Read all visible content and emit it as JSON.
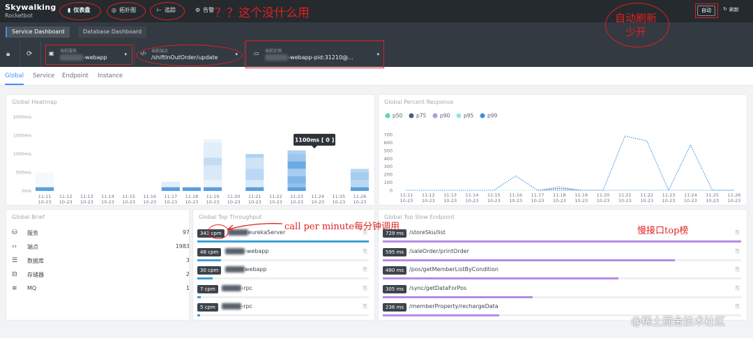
{
  "app": {
    "brand": "Skywalking",
    "subtitle": "Rocketbot"
  },
  "topnav": {
    "items": [
      {
        "label": "仪表盘",
        "icon": "dashboard-icon",
        "glyph": "▮",
        "active": true
      },
      {
        "label": "拓扑图",
        "icon": "topology-icon",
        "glyph": "◎",
        "active": false
      },
      {
        "label": "追踪",
        "icon": "trace-icon",
        "glyph": "⊢",
        "active": false
      },
      {
        "label": "告警",
        "icon": "alarm-icon",
        "glyph": "⚙",
        "active": false
      }
    ],
    "auto_label": "自动",
    "refresh_label": "刷新"
  },
  "dashboards": {
    "tabs": [
      "Service Dashboard",
      "Database Dashboard"
    ],
    "active": 0
  },
  "selectors": {
    "service": {
      "label": "当前服务",
      "value_suffix": "-webapp"
    },
    "endpoint": {
      "label": "当前端点",
      "value": "/shiftInOutOrder/update"
    },
    "instance": {
      "label": "当前实例",
      "value_suffix": "-webapp-pid:31210@..."
    }
  },
  "subtabs": [
    "Global",
    "Service",
    "Endpoint",
    "Instance"
  ],
  "heatmap": {
    "title": "Global Heatmap",
    "tooltip": "1100ms [ 0 ]"
  },
  "percent": {
    "title": "Global Percent Response"
  },
  "chart_data": [
    {
      "type": "heatmap",
      "title": "Global Heatmap",
      "y_ticks": [
        "2000ms",
        "1500ms",
        "1000ms",
        "500ms",
        "0ms"
      ],
      "ylim": [
        0,
        2000
      ],
      "categories": [
        "11:11\n10-23",
        "11:12\n10-23",
        "11:13\n10-23",
        "11:14\n10-23",
        "11:15\n10-23",
        "11:16\n10-23",
        "11:17\n10-23",
        "11:18\n10-23",
        "11:19\n10-23",
        "11:20\n10-23",
        "11:21\n10-23",
        "11:22\n10-23",
        "11:23\n10-23",
        "11:24\n10-23",
        "11:25\n10-23",
        "11:26\n10-23"
      ],
      "cells": [
        {
          "x": 0,
          "bands": [
            [
              0,
              100,
              0.85
            ],
            [
              100,
              500,
              0.05
            ]
          ]
        },
        {
          "x": 6,
          "bands": [
            [
              0,
              100,
              0.85
            ],
            [
              100,
              250,
              0.15
            ]
          ]
        },
        {
          "x": 7,
          "bands": [
            [
              0,
              100,
              0.85
            ]
          ]
        },
        {
          "x": 8,
          "bands": [
            [
              0,
              100,
              0.85
            ],
            [
              100,
              300,
              0.1
            ],
            [
              300,
              700,
              0.2
            ],
            [
              700,
              900,
              0.3
            ],
            [
              900,
              1300,
              0.15
            ],
            [
              1300,
              1400,
              0.1
            ]
          ]
        },
        {
          "x": 10,
          "bands": [
            [
              0,
              100,
              0.85
            ],
            [
              100,
              300,
              0.2
            ],
            [
              300,
              600,
              0.35
            ],
            [
              600,
              900,
              0.25
            ],
            [
              900,
              1000,
              0.4
            ]
          ]
        },
        {
          "x": 12,
          "bands": [
            [
              0,
              100,
              0.85
            ],
            [
              100,
              200,
              0.55
            ],
            [
              200,
              400,
              0.65
            ],
            [
              400,
              600,
              0.45
            ],
            [
              600,
              800,
              0.75
            ],
            [
              800,
              1000,
              0.5
            ],
            [
              1000,
              1100,
              0.4
            ]
          ]
        },
        {
          "x": 15,
          "bands": [
            [
              0,
              100,
              0.85
            ],
            [
              100,
              300,
              0.35
            ],
            [
              300,
              500,
              0.45
            ],
            [
              500,
              600,
              0.35
            ]
          ]
        }
      ]
    },
    {
      "type": "line",
      "title": "Global Percent Response",
      "x": [
        "11:11\n10-23",
        "11:12\n10-23",
        "11:13\n10-23",
        "11:14\n10-23",
        "11:15\n10-23",
        "11:16\n10-23",
        "11:17\n10-23",
        "11:18\n10-23",
        "11:19\n10-23",
        "11:20\n10-23",
        "11:21\n10-23",
        "11:22\n10-23",
        "11:23\n10-23",
        "11:24\n10-23",
        "11:25\n10-23",
        "11:26\n10-23"
      ],
      "ylim": [
        0,
        700
      ],
      "y_ticks": [
        700,
        600,
        500,
        400,
        300,
        200,
        100,
        0
      ],
      "legend": "top-left",
      "series": [
        {
          "name": "p50",
          "color": "#5fd4b3",
          "values": [
            0,
            0,
            0,
            0,
            0,
            0,
            0,
            20,
            0,
            0,
            0,
            0,
            0,
            0,
            0,
            0
          ]
        },
        {
          "name": "p75",
          "color": "#4c5a8c",
          "values": [
            0,
            0,
            0,
            0,
            0,
            0,
            0,
            25,
            0,
            0,
            0,
            0,
            0,
            0,
            0,
            0
          ]
        },
        {
          "name": "p90",
          "color": "#a79ee0",
          "values": [
            0,
            0,
            0,
            0,
            0,
            0,
            0,
            45,
            0,
            0,
            0,
            0,
            0,
            0,
            0,
            0
          ]
        },
        {
          "name": "p95",
          "color": "#9ee3e3",
          "values": [
            0,
            0,
            0,
            0,
            0,
            0,
            0,
            0,
            0,
            0,
            0,
            0,
            0,
            0,
            0,
            0
          ]
        },
        {
          "name": "p99",
          "color": "#3a8fdc",
          "values": [
            0,
            0,
            0,
            0,
            0,
            180,
            0,
            0,
            0,
            0,
            680,
            620,
            0,
            570,
            0,
            0
          ]
        }
      ]
    }
  ],
  "brief": {
    "title": "Global Brief",
    "items": [
      {
        "icon": "database-icon",
        "glyph": "⛁",
        "label": "服务",
        "count": "97"
      },
      {
        "icon": "code-icon",
        "glyph": "‹›",
        "label": "端点",
        "count": "1983"
      },
      {
        "icon": "stack-icon",
        "glyph": "☰",
        "label": "数据库",
        "count": "3"
      },
      {
        "icon": "storage-icon",
        "glyph": "⊟",
        "label": "存储器",
        "count": "2"
      },
      {
        "icon": "queue-icon",
        "glyph": "≡",
        "label": "MQ",
        "count": "1"
      }
    ]
  },
  "throughput": {
    "title": "Global Top Throughput",
    "rows": [
      {
        "badge": "343 cpm",
        "name_suffix": "eurekaServer",
        "ratio": 1.0
      },
      {
        "badge": "48 cpm",
        "name_suffix": "-webapp",
        "ratio": 0.14
      },
      {
        "badge": "30 cpm",
        "name_suffix": "webapp",
        "ratio": 0.09
      },
      {
        "badge": "7 cpm",
        "name_suffix": "-rpc",
        "ratio": 0.02
      },
      {
        "badge": "5 cpm",
        "name_suffix": "-rpc",
        "ratio": 0.015
      }
    ]
  },
  "slow": {
    "title": "Global Top Slow Endpoint",
    "rows": [
      {
        "badge": "729 ms",
        "name": "/storeSku/list",
        "ratio": 1.0
      },
      {
        "badge": "595 ms",
        "name": "/saleOrder/printOrder",
        "ratio": 0.816
      },
      {
        "badge": "480 ms",
        "name": "/pos/getMemberListByCondition",
        "ratio": 0.658
      },
      {
        "badge": "305 ms",
        "name": "/sync/getDataForPos",
        "ratio": 0.418
      },
      {
        "badge": "236 ms",
        "name": "/memberProperty/rechargeData",
        "ratio": 0.324
      }
    ]
  },
  "annotations": {
    "question": "？？这个没什么用",
    "auto_refresh": "自动刷新\n少开",
    "cpm_note": "call per minute每分钟调用",
    "slow_note": "慢接口top榜"
  },
  "watermark": "@稀土掘金技术社区",
  "colors": {
    "accent": "#448dfe",
    "throughput_bar": "#3aa0d8",
    "slow_bar": "#b78be6",
    "annotation": "#e02020"
  }
}
